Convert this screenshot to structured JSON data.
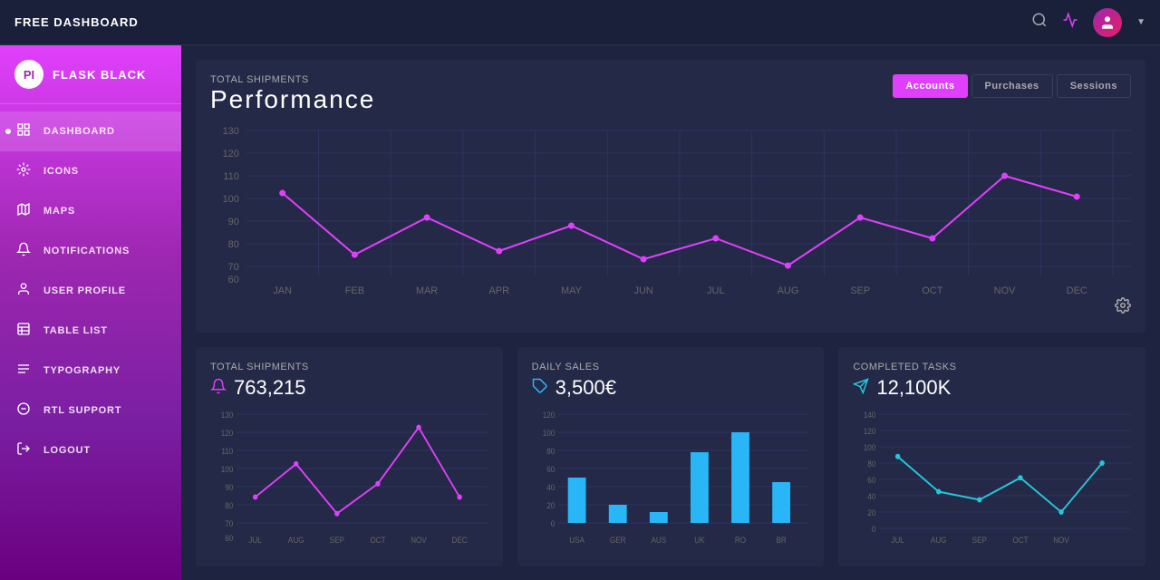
{
  "navbar": {
    "brand": "FREE DASHBOARD",
    "icons": [
      "search",
      "activity",
      "user"
    ],
    "avatar_text": "U"
  },
  "sidebar": {
    "logo_text": "PI",
    "brand": "FLASK BLACK",
    "items": [
      {
        "label": "DASHBOARD",
        "icon": "dashboard",
        "active": true
      },
      {
        "label": "ICONS",
        "icon": "icons"
      },
      {
        "label": "MAPS",
        "icon": "maps"
      },
      {
        "label": "NOTIFICATIONS",
        "icon": "notifications"
      },
      {
        "label": "USER PROFILE",
        "icon": "user"
      },
      {
        "label": "TABLE LIST",
        "icon": "table"
      },
      {
        "label": "TYPOGRAPHY",
        "icon": "typography"
      },
      {
        "label": "RTL SUPPORT",
        "icon": "rtl"
      },
      {
        "label": "LOGOUT",
        "icon": "logout"
      }
    ]
  },
  "main": {
    "top_chart": {
      "subtitle": "Total Shipments",
      "title": "Performance",
      "tabs": [
        "Accounts",
        "Purchases",
        "Sessions"
      ],
      "active_tab": "Accounts",
      "y_labels": [
        "130",
        "120",
        "110",
        "100",
        "90",
        "80",
        "70",
        "60"
      ],
      "x_labels": [
        "JAN",
        "FEB",
        "MAR",
        "APR",
        "MAY",
        "JUN",
        "JUL",
        "AUG",
        "SEP",
        "OCT",
        "NOV",
        "DEC"
      ],
      "data_points": [
        100,
        70,
        88,
        72,
        84,
        68,
        78,
        65,
        88,
        78,
        108,
        98
      ]
    },
    "bottom_cards": [
      {
        "title": "Total Shipments",
        "value": "763,215",
        "value_icon": "bell",
        "value_icon_color": "pink",
        "chart_type": "line",
        "y_labels": [
          "130",
          "120",
          "110",
          "100",
          "90",
          "80",
          "70",
          "60"
        ],
        "x_labels": [
          "JUL",
          "AUG",
          "SEP",
          "OCT",
          "NOV",
          "DEC"
        ],
        "data_points": [
          80,
          100,
          70,
          88,
          122,
          80
        ]
      },
      {
        "title": "Daily Sales",
        "value": "3,500€",
        "value_icon": "tag",
        "value_icon_color": "blue",
        "chart_type": "bar",
        "y_labels": [
          "120",
          "100",
          "80",
          "60",
          "40",
          "20",
          "0"
        ],
        "x_labels": [
          "USA",
          "GER",
          "AUS",
          "UK",
          "RO",
          "BR"
        ],
        "bar_values": [
          50,
          20,
          12,
          78,
          100,
          45
        ]
      },
      {
        "title": "Completed Tasks",
        "value": "12,100K",
        "value_icon": "send",
        "value_icon_color": "teal",
        "chart_type": "line",
        "y_labels": [
          "140",
          "120",
          "100",
          "80",
          "60",
          "40",
          "20",
          "0"
        ],
        "x_labels": [
          "JUL",
          "AUG",
          "SEP",
          "OCT",
          "NOV"
        ],
        "data_points": [
          88,
          45,
          35,
          62,
          20,
          80
        ]
      }
    ]
  }
}
